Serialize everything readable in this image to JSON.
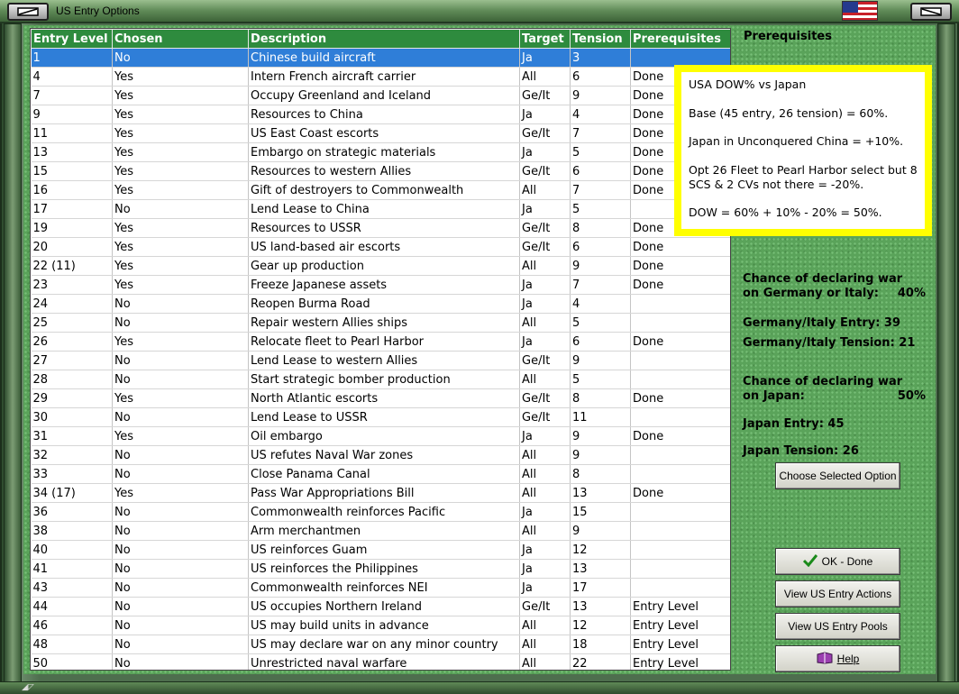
{
  "window": {
    "title": "US Entry Options"
  },
  "table": {
    "columns": [
      "Entry Level",
      "Chosen",
      "Description",
      "Target",
      "Tension",
      "Prerequisites"
    ],
    "rows": [
      [
        "1",
        "No",
        "Chinese build aircraft",
        "Ja",
        "3",
        ""
      ],
      [
        "4",
        "Yes",
        "Intern French aircraft carrier",
        "All",
        "6",
        "Done"
      ],
      [
        "7",
        "Yes",
        "Occupy Greenland and Iceland",
        "Ge/It",
        "9",
        "Done"
      ],
      [
        "9",
        "Yes",
        "Resources to China",
        "Ja",
        "4",
        "Done"
      ],
      [
        "11",
        "Yes",
        "US East Coast escorts",
        "Ge/It",
        "7",
        "Done"
      ],
      [
        "13",
        "Yes",
        "Embargo on strategic materials",
        "Ja",
        "5",
        "Done"
      ],
      [
        "15",
        "Yes",
        "Resources to western Allies",
        "Ge/It",
        "6",
        "Done"
      ],
      [
        "16",
        "Yes",
        "Gift of destroyers to Commonwealth",
        "All",
        "7",
        "Done"
      ],
      [
        "17",
        "No",
        "Lend Lease to China",
        "Ja",
        "5",
        ""
      ],
      [
        "19",
        "Yes",
        "Resources to USSR",
        "Ge/It",
        "8",
        "Done"
      ],
      [
        "20",
        "Yes",
        "US land-based air escorts",
        "Ge/It",
        "6",
        "Done"
      ],
      [
        "22 (11)",
        "Yes",
        "Gear up production",
        "All",
        "9",
        "Done"
      ],
      [
        "23",
        "Yes",
        "Freeze Japanese assets",
        "Ja",
        "7",
        "Done"
      ],
      [
        "24",
        "No",
        "Reopen Burma Road",
        "Ja",
        "4",
        ""
      ],
      [
        "25",
        "No",
        "Repair western Allies ships",
        "All",
        "5",
        ""
      ],
      [
        "26",
        "Yes",
        "Relocate fleet to Pearl Harbor",
        "Ja",
        "6",
        "Done"
      ],
      [
        "27",
        "No",
        "Lend Lease to western Allies",
        "Ge/It",
        "9",
        ""
      ],
      [
        "28",
        "No",
        "Start strategic bomber production",
        "All",
        "5",
        ""
      ],
      [
        "29",
        "Yes",
        "North Atlantic escorts",
        "Ge/It",
        "8",
        "Done"
      ],
      [
        "30",
        "No",
        "Lend Lease to USSR",
        "Ge/It",
        "11",
        ""
      ],
      [
        "31",
        "Yes",
        "Oil embargo",
        "Ja",
        "9",
        "Done"
      ],
      [
        "32",
        "No",
        "US refutes Naval War zones",
        "All",
        "9",
        ""
      ],
      [
        "33",
        "No",
        "Close Panama Canal",
        "All",
        "8",
        ""
      ],
      [
        "34 (17)",
        "Yes",
        "Pass War Appropriations Bill",
        "All",
        "13",
        "Done"
      ],
      [
        "36",
        "No",
        "Commonwealth reinforces Pacific",
        "Ja",
        "15",
        ""
      ],
      [
        "38",
        "No",
        "Arm merchantmen",
        "All",
        "9",
        ""
      ],
      [
        "40",
        "No",
        "US reinforces Guam",
        "Ja",
        "12",
        ""
      ],
      [
        "41",
        "No",
        "US reinforces the Philippines",
        "Ja",
        "13",
        ""
      ],
      [
        "43",
        "No",
        "Commonwealth reinforces NEI",
        "Ja",
        "17",
        ""
      ],
      [
        "44",
        "No",
        "US occupies Northern Ireland",
        "Ge/It",
        "13",
        "Entry Level"
      ],
      [
        "46",
        "No",
        "US may build units in advance",
        "All",
        "12",
        "Entry Level"
      ],
      [
        "48",
        "No",
        "US may declare war on any minor country",
        "All",
        "18",
        "Entry Level"
      ],
      [
        "50",
        "No",
        "Unrestricted naval warfare",
        "All",
        "22",
        "Entry Level"
      ]
    ]
  },
  "prerequisites": {
    "heading": "Prerequisites",
    "note_lines": [
      "USA DOW% vs Japan",
      "Base (45 entry, 26 tension) = 60%.",
      "Japan in Unconquered China = +10%.",
      "Opt 26 Fleet to Pearl Harbor select but 8 SCS & 2 CVs not there = -20%.",
      "DOW = 60% + 10% - 20% = 50%."
    ]
  },
  "stats": {
    "ge_chance_line1": "Chance of declaring war",
    "ge_chance_line2": "on Germany or Italy:",
    "ge_chance_value": "40%",
    "ge_entry": "Germany/Italy Entry: 39",
    "ge_tension": "Germany/Italy Tension: 21",
    "ja_chance_line1": "Chance of declaring war",
    "ja_chance_line2": "on Japan:",
    "ja_chance_value": "50%",
    "ja_entry": "Japan Entry: 45",
    "ja_tension": "Japan Tension: 26"
  },
  "buttons": {
    "choose": "Choose Selected Option",
    "ok": "OK - Done",
    "view_actions": "View US Entry Actions",
    "view_pools": "View US Entry Pools",
    "help": "Help"
  },
  "colors": {
    "header_green": "#2e8b3e",
    "selected_row": "#2f7ed8",
    "note_border": "#ffff00",
    "panel_green": "#5aa35a"
  },
  "icons": {
    "titlebar_left": "restore-icon",
    "titlebar_right": "minimize-icon",
    "flag": "us-flag-icon",
    "ok": "checkmark-icon",
    "help": "help-book-icon"
  },
  "selected_row_index": 0
}
